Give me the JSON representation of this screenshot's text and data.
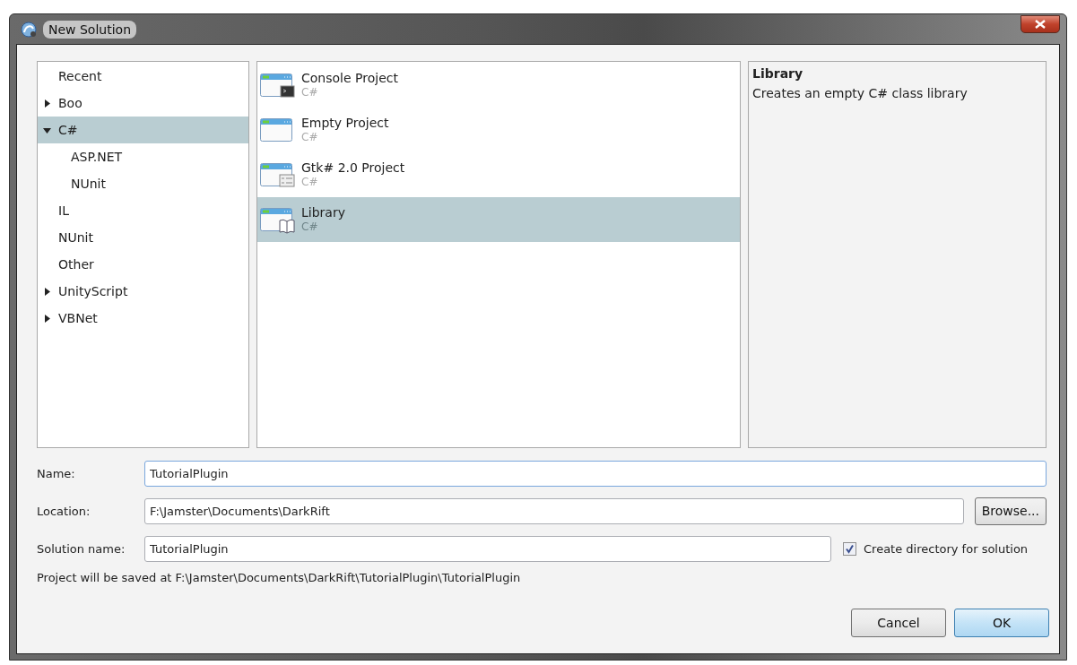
{
  "window": {
    "title": "New Solution"
  },
  "categories": [
    {
      "label": "Recent",
      "selected": false
    },
    {
      "label": "Boo",
      "selected": false,
      "expanded": false
    },
    {
      "label": "C#",
      "selected": true,
      "expanded": true,
      "children": [
        {
          "label": "ASP.NET",
          "selected": false
        },
        {
          "label": "NUnit",
          "selected": false
        }
      ]
    },
    {
      "label": "IL",
      "selected": false
    },
    {
      "label": "NUnit",
      "selected": false
    },
    {
      "label": "Other",
      "selected": false
    },
    {
      "label": "UnityScript",
      "selected": false,
      "expanded": false
    },
    {
      "label": "VBNet",
      "selected": false,
      "expanded": false
    }
  ],
  "templates": [
    {
      "name": "Console Project",
      "language": "C#",
      "kind": "console",
      "selected": false
    },
    {
      "name": "Empty Project",
      "language": "C#",
      "kind": "empty",
      "selected": false
    },
    {
      "name": "Gtk# 2.0 Project",
      "language": "C#",
      "kind": "gtk",
      "selected": false
    },
    {
      "name": "Library",
      "language": "C#",
      "kind": "library",
      "selected": true
    }
  ],
  "description": {
    "title": "Library",
    "text": "Creates an empty C# class library"
  },
  "form": {
    "name": {
      "label": "Name:",
      "value": "TutorialPlugin",
      "focused": true
    },
    "location": {
      "label": "Location:",
      "value": "F:\\Jamster\\Documents\\DarkRift",
      "focused": false
    },
    "browse_button": "Browse...",
    "solution_name": {
      "label": "Solution name:",
      "value": "TutorialPlugin",
      "focused": false
    },
    "create_directory": {
      "label": "Create directory for solution",
      "checked": true
    },
    "info": "Project will be saved at F:\\Jamster\\Documents\\DarkRift\\TutorialPlugin\\TutorialPlugin"
  },
  "buttons": [
    {
      "label": "Cancel",
      "kind": "normal"
    },
    {
      "label": "OK",
      "kind": "default"
    }
  ]
}
